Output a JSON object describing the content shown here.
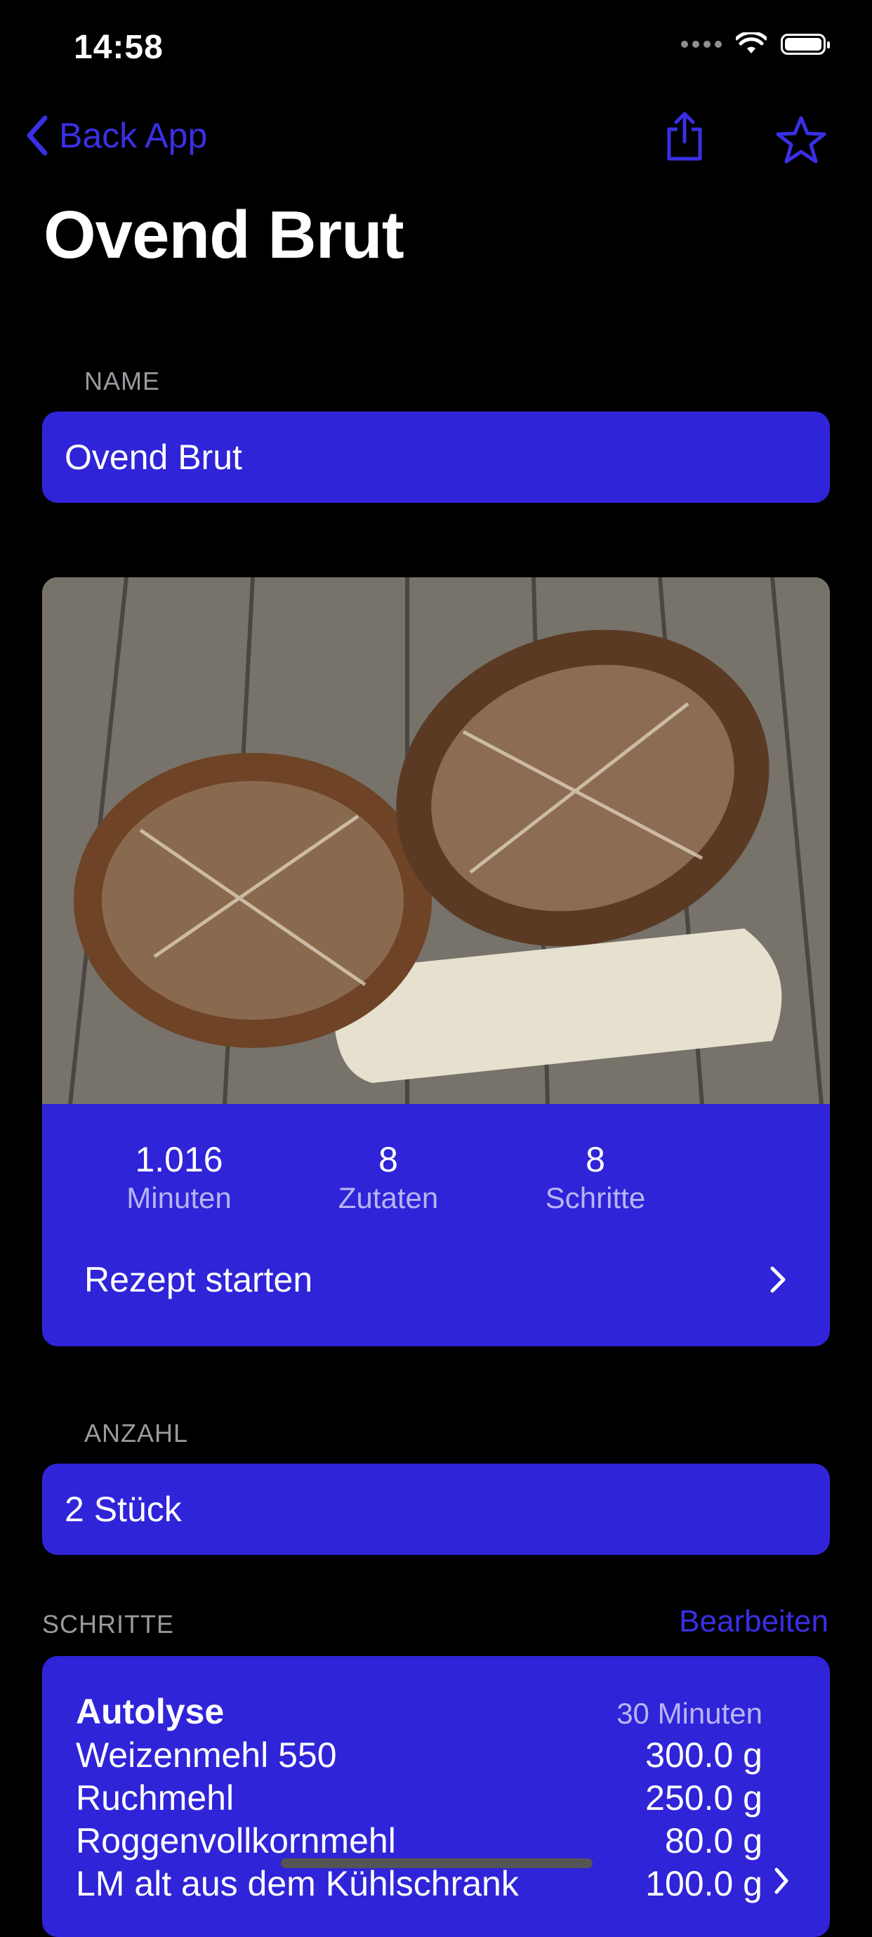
{
  "status_bar": {
    "time": "14:58"
  },
  "nav": {
    "back_label": "Back App",
    "share_icon": "share-icon",
    "favorite_icon": "star-icon"
  },
  "title": "Ovend Brut",
  "name_section": {
    "label": "NAME",
    "value": "Ovend Brut"
  },
  "recipe_card": {
    "image_alt": "two-loaves-of-bread-photo",
    "stats": [
      {
        "value": "1.016",
        "label": "Minuten"
      },
      {
        "value": "8",
        "label": "Zutaten"
      },
      {
        "value": "8",
        "label": "Schritte"
      }
    ],
    "start_label": "Rezept starten"
  },
  "count_section": {
    "label": "ANZAHL",
    "value": "2 Stück"
  },
  "steps_section": {
    "label": "SCHRITTE",
    "edit_label": "Bearbeiten",
    "step": {
      "title": "Autolyse",
      "duration": "30 Minuten",
      "ingredients": [
        {
          "name": "Weizenmehl 550",
          "amount": "300.0 g"
        },
        {
          "name": "Ruchmehl",
          "amount": "250.0 g"
        },
        {
          "name": "Roggenvollkornmehl",
          "amount": "80.0 g"
        },
        {
          "name": "LM alt aus dem Kühlschrank",
          "amount": "100.0 g"
        }
      ]
    }
  },
  "colors": {
    "accent": "#2f24d8",
    "accent_text": "#3a2fe6",
    "background": "#000000"
  }
}
